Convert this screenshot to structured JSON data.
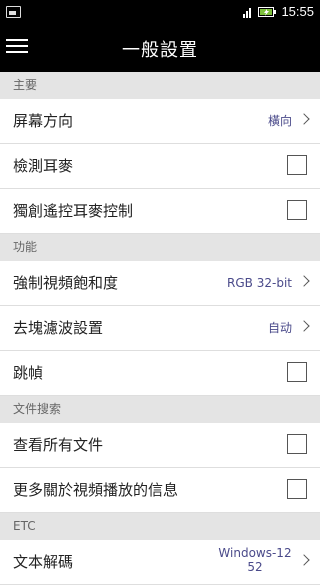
{
  "status": {
    "time": "15:55",
    "battery_icon": "battery-charging-icon",
    "signal_icon": "signal-icon"
  },
  "header": {
    "title": "一般設置"
  },
  "sections": [
    {
      "label": "主要",
      "rows": [
        {
          "label": "屏幕方向",
          "value": "橫向",
          "type": "select"
        },
        {
          "label": "檢測耳麥",
          "type": "checkbox",
          "checked": false
        },
        {
          "label": "獨創遙控耳麥控制",
          "type": "checkbox",
          "checked": false
        }
      ]
    },
    {
      "label": "功能",
      "rows": [
        {
          "label": "強制視頻飽和度",
          "value": "RGB 32-bit",
          "type": "select"
        },
        {
          "label": "去塊濾波設置",
          "value": "自动",
          "type": "select"
        },
        {
          "label": "跳幀",
          "type": "checkbox",
          "checked": false
        }
      ]
    },
    {
      "label": "文件搜索",
      "rows": [
        {
          "label": "查看所有文件",
          "type": "checkbox",
          "checked": false
        },
        {
          "label": "更多關於視頻播放的信息",
          "type": "checkbox",
          "checked": false
        }
      ]
    },
    {
      "label": "ETC",
      "rows": [
        {
          "label": "文本解碼",
          "value": "Windows-1252",
          "value_line1": "Windows-12",
          "value_line2": "52",
          "type": "select"
        }
      ]
    }
  ]
}
